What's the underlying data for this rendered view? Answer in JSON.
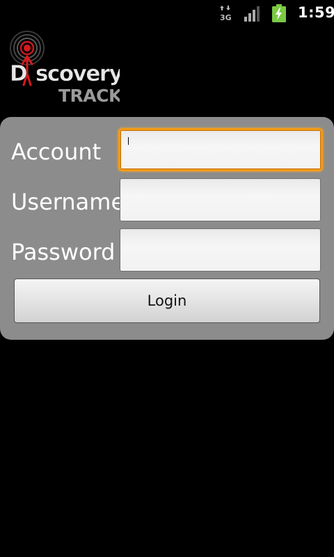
{
  "status_bar": {
    "network_type": "3G",
    "clock": "1:59",
    "icons": [
      "data-3g-icon",
      "signal-strength-icon",
      "battery-charging-icon"
    ]
  },
  "logo": {
    "brand_line1": "Discovery",
    "brand_line2": "TRACK"
  },
  "form": {
    "account_label": "Account",
    "account_value": "",
    "username_label": "Username",
    "username_value": "",
    "password_label": "Password",
    "password_value": "",
    "login_label": "Login"
  },
  "colors": {
    "background": "#000000",
    "panel": "#8c8c8c",
    "focus_ring": "#f49a14",
    "battery_green": "#7ac943",
    "logo_red": "#d7191c"
  }
}
